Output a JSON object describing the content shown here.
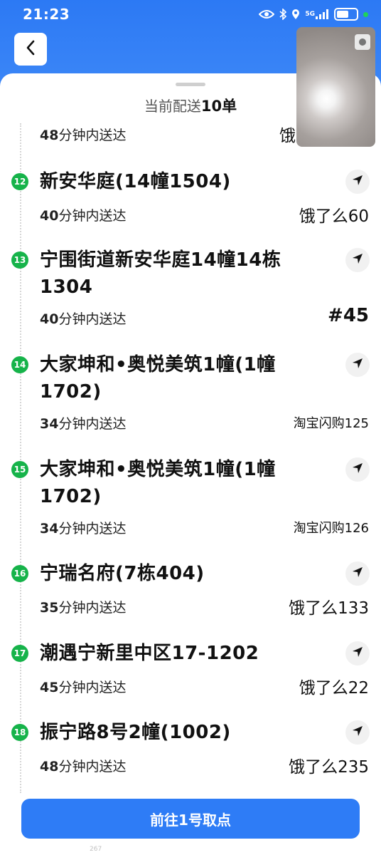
{
  "status_bar": {
    "time": "21:23",
    "network": "5G",
    "icons": [
      "eye-icon",
      "bluetooth-icon",
      "location-icon",
      "signal-icon",
      "battery-icon"
    ]
  },
  "header": {
    "back_icon": "chevron-left-icon"
  },
  "sheet": {
    "title_prefix": "当前配送",
    "title_count": "10单"
  },
  "orders": [
    {
      "index": "",
      "address": "",
      "eta_minutes": "48",
      "eta_suffix": "分钟内送达",
      "code": "饿"
    },
    {
      "index": "12",
      "address": "新安华庭(14幢1504)",
      "eta_minutes": "40",
      "eta_suffix": "分钟内送达",
      "code": "饿了么60"
    },
    {
      "index": "13",
      "address": "宁围街道新安华庭14幢14栋1304",
      "eta_minutes": "40",
      "eta_suffix": "分钟内送达",
      "code": "#45"
    },
    {
      "index": "14",
      "address": "大家坤和•奥悦美筑1幢(1幢1702)",
      "eta_minutes": "34",
      "eta_suffix": "分钟内送达",
      "code": "淘宝闪购125"
    },
    {
      "index": "15",
      "address": "大家坤和•奥悦美筑1幢(1幢1702)",
      "eta_minutes": "34",
      "eta_suffix": "分钟内送达",
      "code": "淘宝闪购126"
    },
    {
      "index": "16",
      "address": "宁瑞名府(7栋404)",
      "eta_minutes": "35",
      "eta_suffix": "分钟内送达",
      "code": "饿了么133"
    },
    {
      "index": "17",
      "address": "潮遇宁新里中区17-1202",
      "eta_minutes": "45",
      "eta_suffix": "分钟内送达",
      "code": "饿了么22"
    },
    {
      "index": "18",
      "address": "振宁路8号2幢(1002)",
      "eta_minutes": "48",
      "eta_suffix": "分钟内送达",
      "code": "饿了么235"
    }
  ],
  "bottom": {
    "primary_button": "前往1号取点",
    "hint": "267"
  },
  "colors": {
    "accent_blue": "#2e7cf6",
    "badge_green": "#16b34a"
  }
}
